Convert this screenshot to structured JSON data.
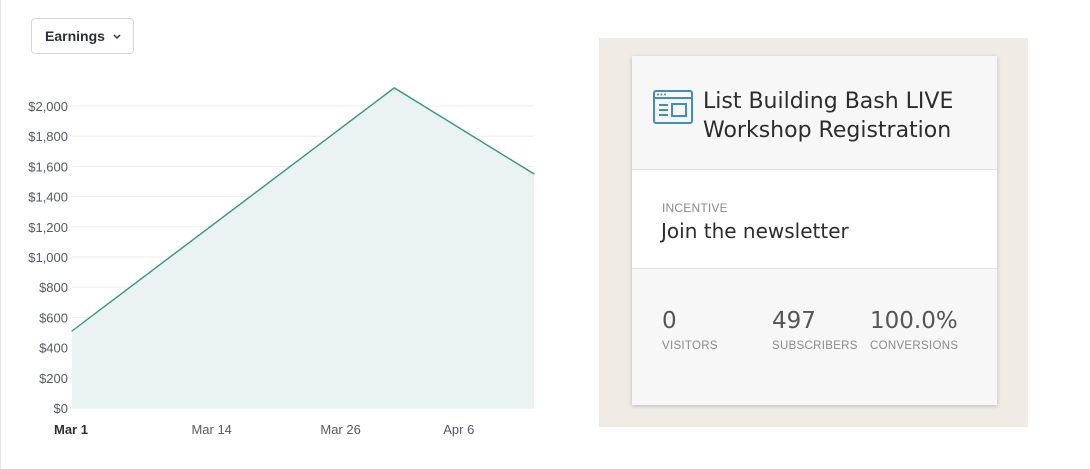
{
  "dropdown": {
    "label": "Earnings",
    "icon": "chevron-down-icon"
  },
  "chart_data": {
    "type": "area",
    "title": "",
    "xlabel": "",
    "ylabel": "",
    "ylim": [
      0,
      2000
    ],
    "y_ticks": [
      0,
      200,
      400,
      600,
      800,
      1000,
      1200,
      1400,
      1600,
      1800,
      2000
    ],
    "y_tick_labels": [
      "$0",
      "$200",
      "$400",
      "$600",
      "$800",
      "$1,000",
      "$1,200",
      "$1,400",
      "$1,600",
      "$1,800",
      "$2,000"
    ],
    "x_tick_labels": [
      "Mar 1",
      "Mar 14",
      "Mar 26",
      "Apr 6"
    ],
    "x_tick_dates": [
      "Mar 1",
      "Mar 14",
      "Mar 26",
      "Apr 6"
    ],
    "series": [
      {
        "values": [
          {
            "x": "Mar 1",
            "y": 510
          },
          {
            "x": "Mar 31",
            "y": 2120
          },
          {
            "x": "Apr 13",
            "y": 1550
          }
        ]
      }
    ],
    "grid": true,
    "line_color": "#2e9a7e",
    "fill_color": "#eaf3f1"
  },
  "card": {
    "icon": "browser-window-icon",
    "title": "List Building Bash LIVE Workshop Registration",
    "incentive_label": "INCENTIVE",
    "incentive_value": "Join the newsletter",
    "stats": [
      {
        "value": "0",
        "label": "VISITORS"
      },
      {
        "value": "497",
        "label": "SUBSCRIBERS"
      },
      {
        "value": "100.0%",
        "label": "CONVERSIONS"
      }
    ]
  }
}
